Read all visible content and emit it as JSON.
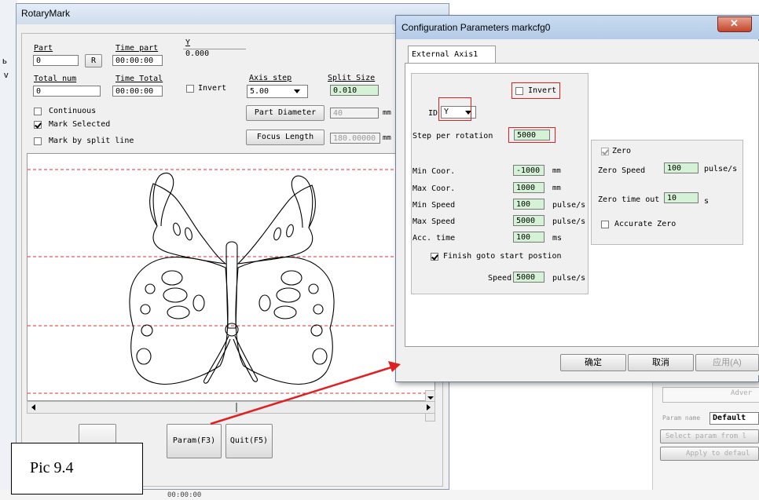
{
  "rotary": {
    "title": "RotaryMark",
    "part_label": "Part",
    "part_value": "0",
    "r_button": "R",
    "time_part_label": "Time part",
    "time_part_value": "00:00:00",
    "y_label": "Y",
    "y_value": "0.000",
    "total_num_label": "Total num",
    "total_num_value": "0",
    "time_total_label": "Time Total",
    "time_total_value": "00:00:00",
    "invert_label": "Invert",
    "axis_step_label": "Axis step",
    "axis_step_value": "5.00",
    "split_size_label": "Split Size",
    "split_size_value": "0.010",
    "continuous_label": "Continuous",
    "mark_selected_label": "Mark Selected",
    "mark_split_label": "Mark by split line",
    "part_diameter_button": "Part Diameter",
    "part_diameter_value": "40",
    "focus_length_button": "Focus Length",
    "focus_length_value": "180.00000",
    "unit_mm": "mm",
    "param_button": "Param(F3)",
    "quit_button": "Quit(F5)"
  },
  "caption": "Pic 9.4",
  "dialog": {
    "title": "Configuration Parameters markcfg0",
    "tab": "External Axis1",
    "invert_label": "Invert",
    "id_label": "ID",
    "id_value": "Y",
    "step_label": "Step per rotation",
    "step_value": "5000",
    "min_coor_label": "Min Coor.",
    "min_coor_value": "-1000",
    "max_coor_label": "Max Coor.",
    "max_coor_value": "1000",
    "min_speed_label": "Min Speed",
    "min_speed_value": "100",
    "max_speed_label": "Max Speed",
    "max_speed_value": "5000",
    "acc_label": "Acc. time",
    "acc_value": "100",
    "unit_mm": "mm",
    "unit_pulse": "pulse/s",
    "unit_ms": "ms",
    "unit_s": "s",
    "finish_label": "Finish goto start postion",
    "speed_label": "Speed",
    "speed_value": "5000",
    "zero_label": "Zero",
    "zero_speed_label": "Zero Speed",
    "zero_speed_value": "100",
    "zero_timeout_label": "Zero time out",
    "zero_timeout_value": "10",
    "accurate_zero_label": "Accurate Zero",
    "ok_button": "确定",
    "cancel_button": "取消",
    "apply_button": "应用(A)"
  },
  "right_panel": {
    "adv_text": "Adver",
    "param_name_label": "Param name",
    "param_name_value": "Default",
    "select_param": "Select param from l",
    "apply_default": "Apply to defaul"
  },
  "bottom_text": "00:00:00"
}
